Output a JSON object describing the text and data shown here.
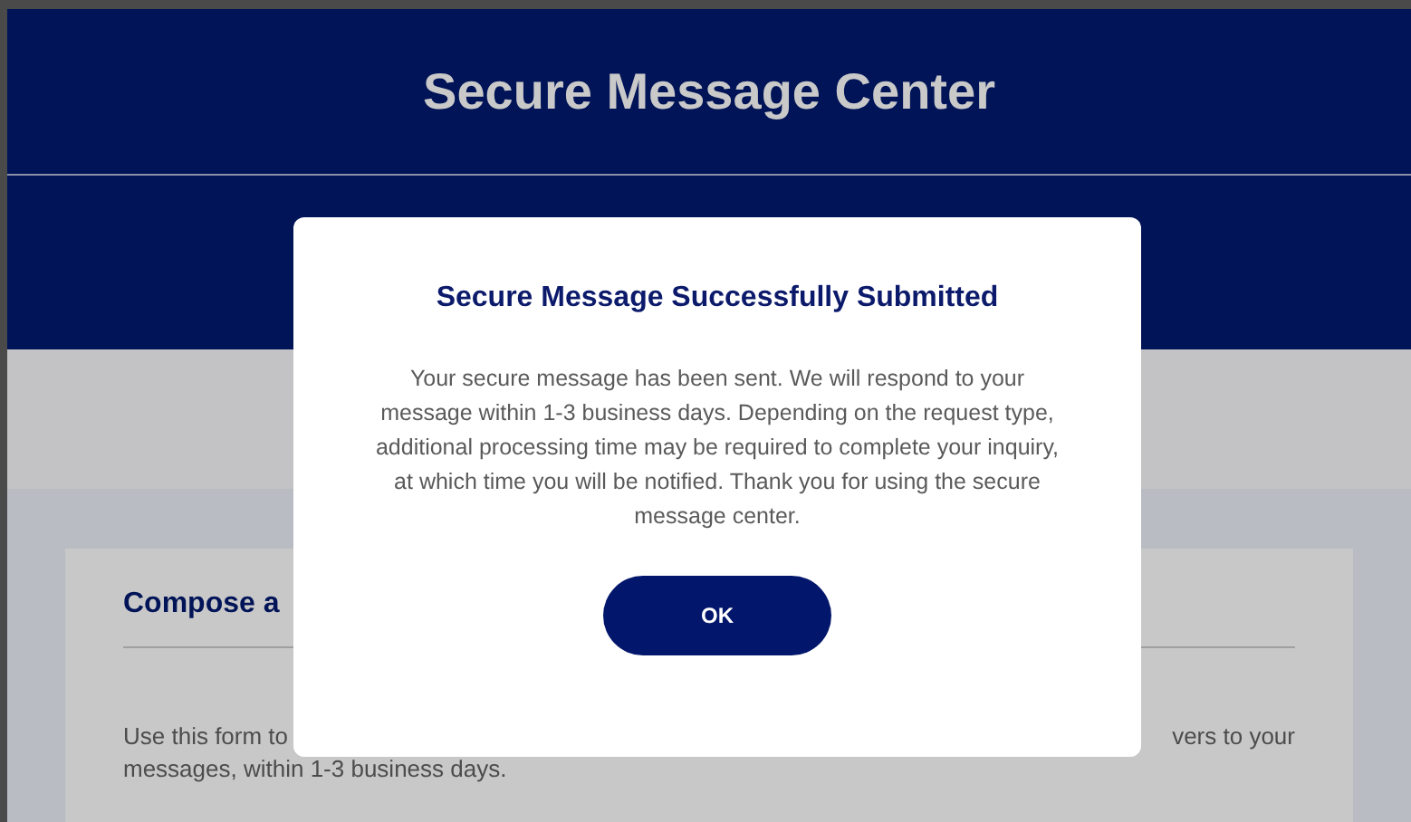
{
  "header": {
    "title": "Secure Message Center"
  },
  "compose_card": {
    "heading": "Compose a",
    "intro_line_start": "Use this form to",
    "intro_line_end": "vers to your",
    "intro_line_2": "messages, within 1-3 business days."
  },
  "modal": {
    "title": "Secure Message Successfully Submitted",
    "message": "Your secure message has been sent. We will respond to your message within 1-3 business days. Depending on the request type, additional processing time may be required to complete your inquiry, at which time you will be notified. Thank you for using the secure message center.",
    "button": "OK"
  }
}
